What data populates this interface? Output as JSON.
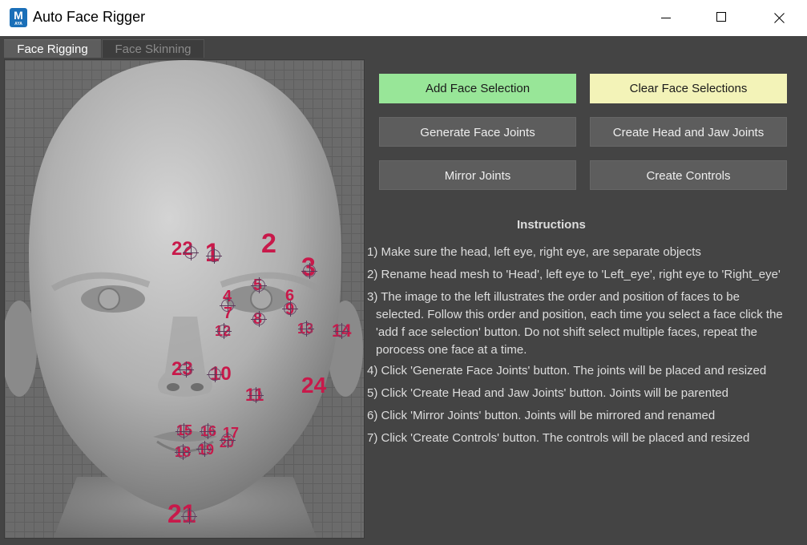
{
  "window": {
    "title": "Auto Face Rigger",
    "icon_letter": "M",
    "icon_sub": "AYA"
  },
  "tabs": [
    {
      "label": "Face Rigging",
      "active": true
    },
    {
      "label": "Face Skinning",
      "active": false
    }
  ],
  "buttons": {
    "add_face_selection": "Add Face Selection",
    "clear_face_selections": "Clear Face Selections",
    "generate_face_joints": "Generate Face Joints",
    "create_head_jaw_joints": "Create Head and Jaw Joints",
    "mirror_joints": "Mirror Joints",
    "create_controls": "Create Controls"
  },
  "instructions": {
    "heading": "Instructions",
    "step1": "1) Make sure the head, left eye, right eye, are separate objects",
    "step2": "2) Rename head mesh to 'Head', left eye to 'Left_eye', right eye to 'Right_eye'",
    "step3_l1": "3) The image to the left illustrates the order and position of faces to be",
    "step3_l2": "selected. Follow this order and position, each time you select a face click the",
    "step3_l3": "'add f ace selection' button. Do not shift select multiple faces, repeat the",
    "step3_l4": "porocess one face at a time.",
    "step4": "4) Click 'Generate Face Joints' button. The joints will be placed and resized",
    "step5": "5) Click 'Create Head and Jaw Joints' button. Joints will be parented",
    "step6": "6) Click 'Mirror Joints' button. Joints will be mirrored and renamed",
    "step7": "7) Click 'Create Controls' button. The controls will be placed and resized"
  },
  "face_markers": [
    "22",
    "1",
    "2",
    "3",
    "4",
    "5",
    "6",
    "7",
    "8",
    "9",
    "10",
    "11",
    "12",
    "13",
    "14",
    "15",
    "16",
    "17",
    "18",
    "19",
    "20",
    "21",
    "23",
    "24"
  ],
  "colors": {
    "add_button": "#98e698",
    "clear_button": "#f3f3b8",
    "marker": "#c8194a"
  }
}
